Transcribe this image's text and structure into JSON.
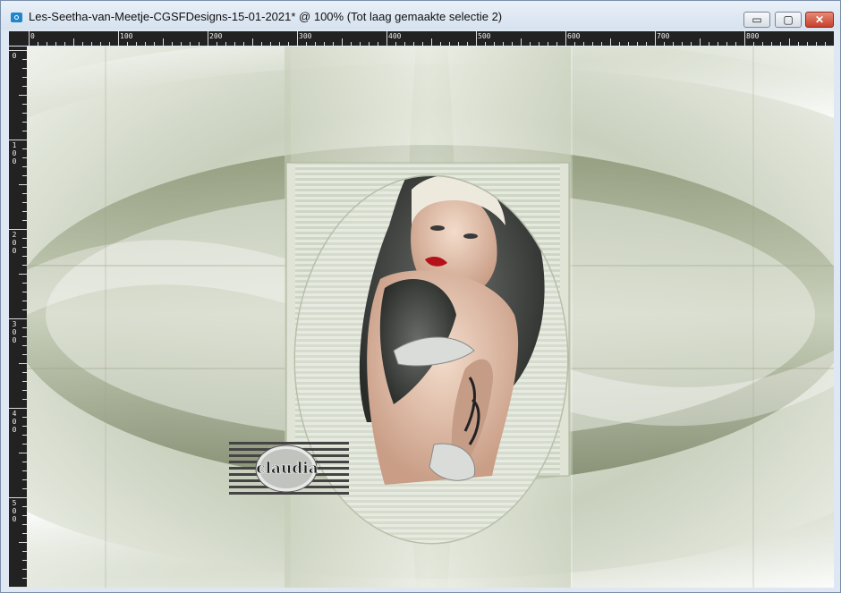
{
  "window": {
    "title": "Les-Seetha-van-Meetje-CGSFDesigns-15-01-2021* @ 100% (Tot laag gemaakte selectie 2)",
    "buttons": {
      "minimize": "▭",
      "maximize": "▢",
      "close": "✕"
    }
  },
  "ruler": {
    "h_labels": [
      "0",
      "100",
      "200",
      "300",
      "400",
      "500",
      "600",
      "700",
      "800"
    ],
    "v_labels": [
      "0",
      "100",
      "200",
      "300",
      "400",
      "500"
    ]
  },
  "canvas": {
    "watermark_text": "claudia"
  },
  "colors": {
    "accent_sage": "#8f9a7a",
    "light_sage": "#e4e9de",
    "ruler_bg": "#222222",
    "close_red": "#c6402c"
  }
}
